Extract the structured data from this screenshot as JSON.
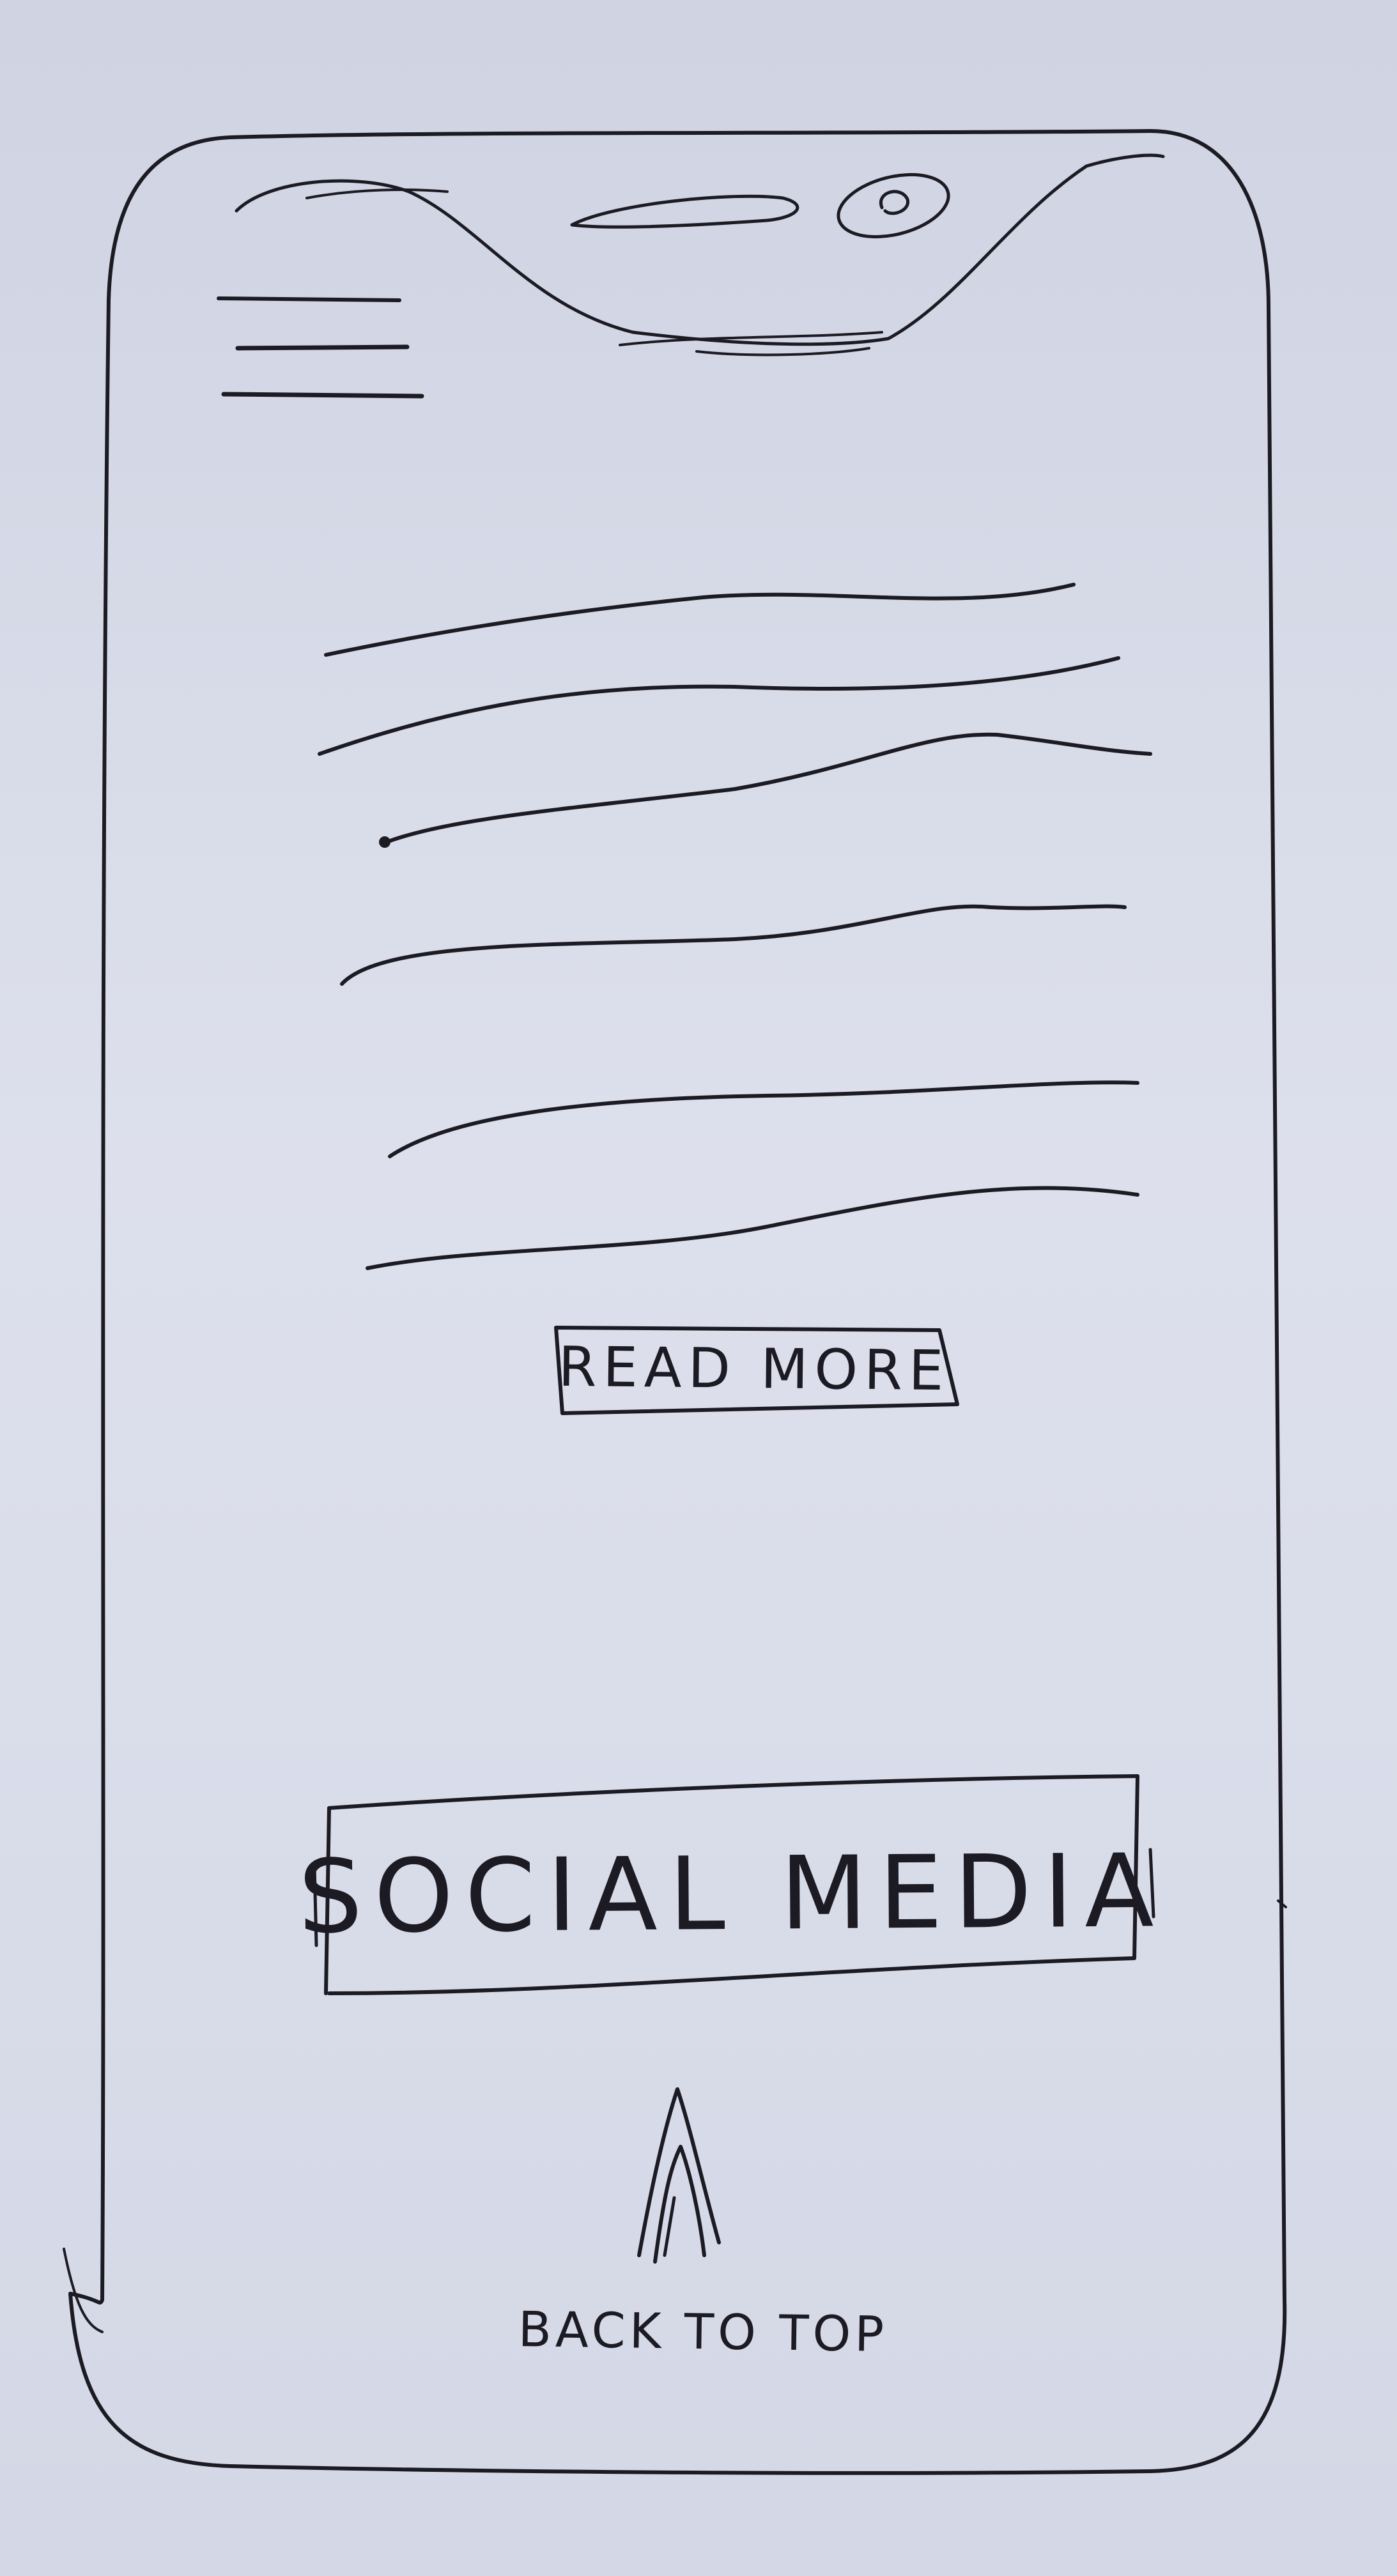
{
  "menu": {
    "icon": "hamburger-menu-icon"
  },
  "content": {
    "placeholder_lines": 6
  },
  "read_more": {
    "label": "READ MORE"
  },
  "social": {
    "label": "SOCIAL MEDIA"
  },
  "back_to_top": {
    "label": "BACK TO TOP",
    "icon": "double-up-arrow-icon"
  },
  "colors": {
    "ink": "#1c1a22",
    "paper": "#d6dae8"
  }
}
